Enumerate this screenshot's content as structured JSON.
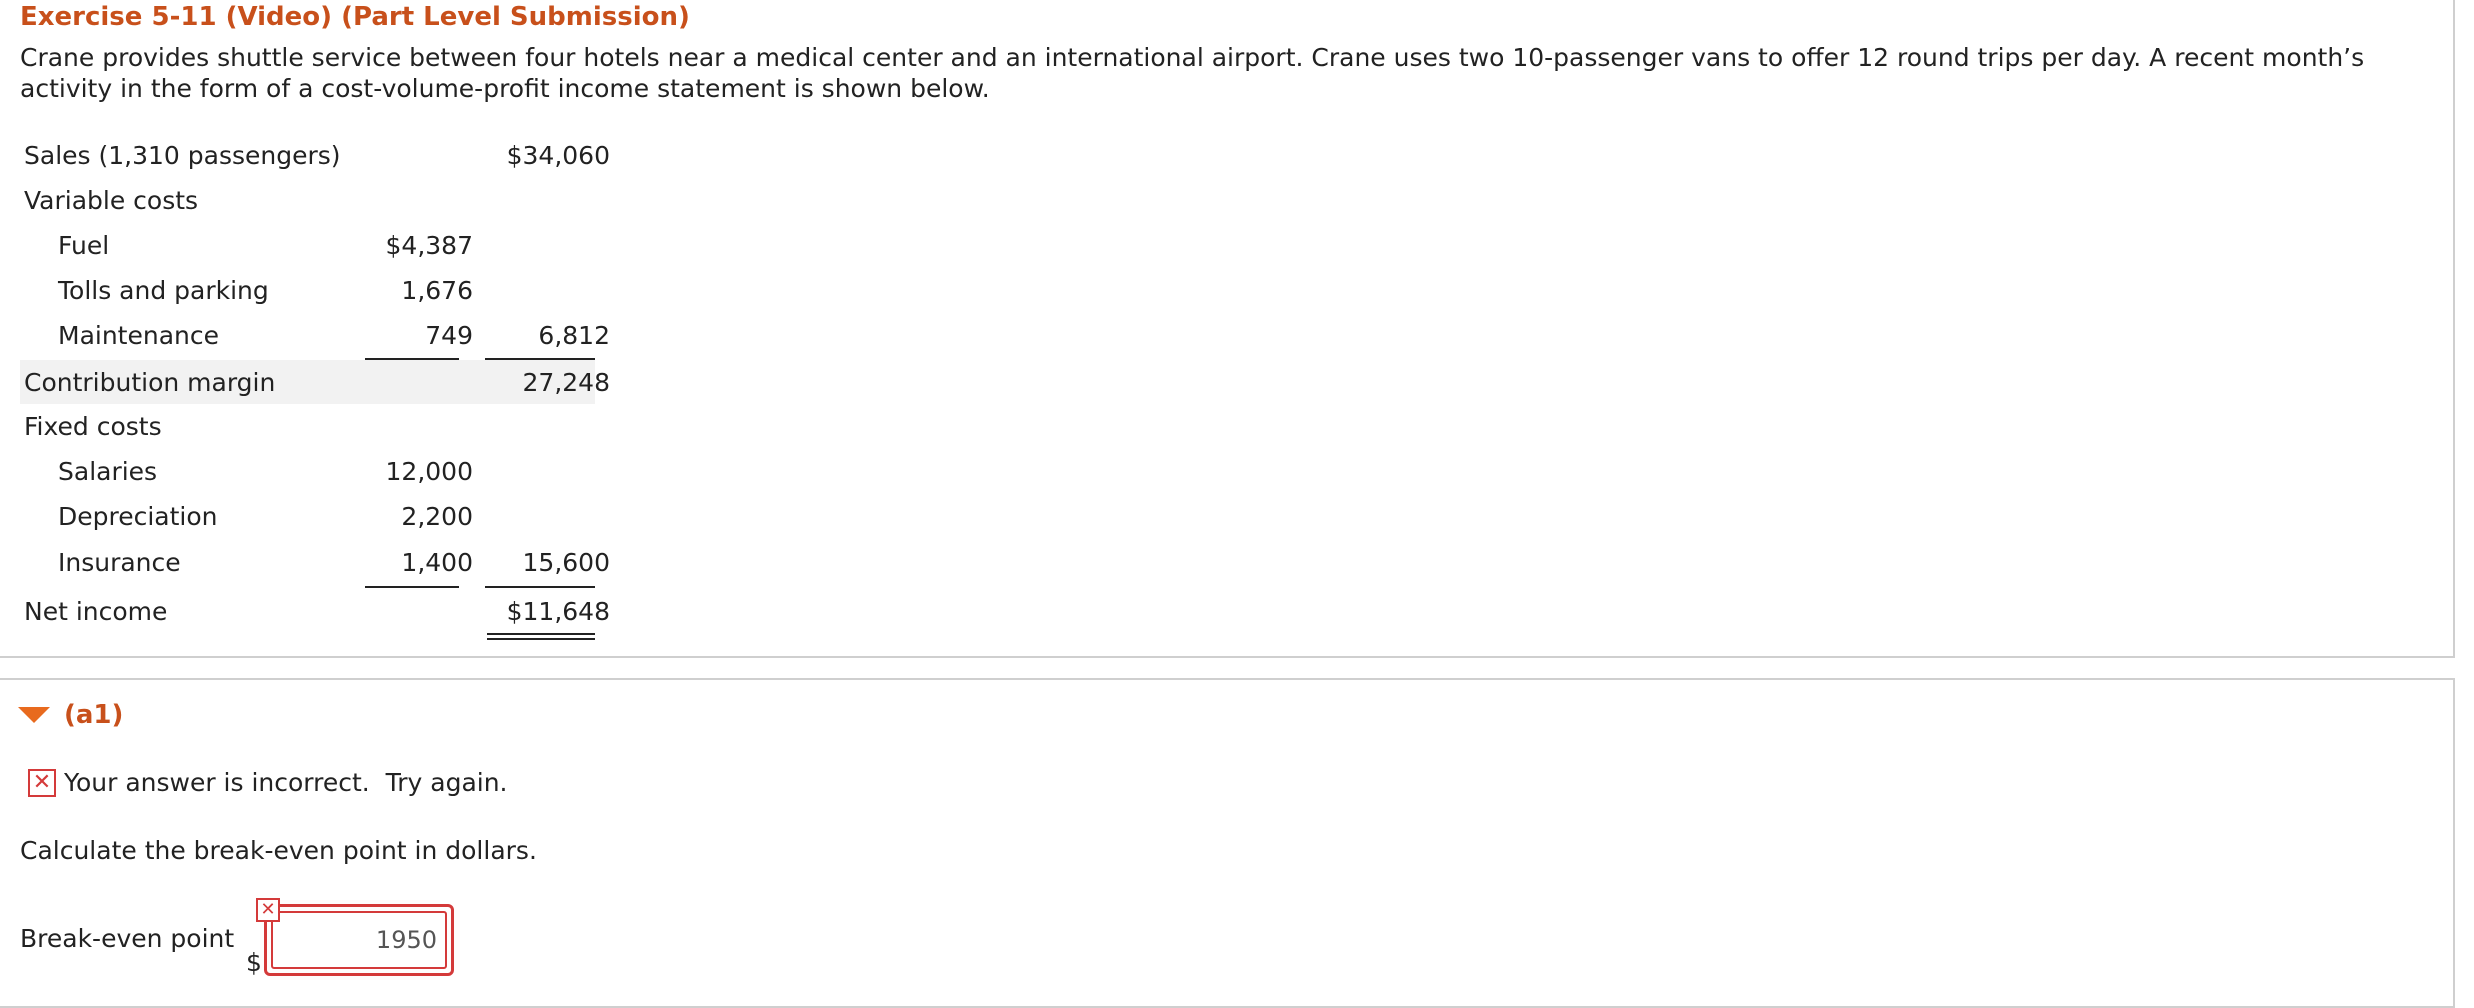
{
  "title": "Exercise 5-11 (Video) (Part Level Submission)",
  "description": "Crane provides shuttle service between four hotels near a medical center and an international airport. Crane uses two 10-passenger vans to offer 12 round trips per day. A recent month’s activity in the form of a cost-volume-profit income statement is shown below.",
  "statement": {
    "sales": {
      "label": "Sales (1,310 passengers)",
      "total": "$34,060"
    },
    "variable_costs": {
      "label": "Variable costs"
    },
    "fuel": {
      "label": "Fuel",
      "amount": "$4,387"
    },
    "tolls": {
      "label": "Tolls and parking",
      "amount": "1,676"
    },
    "maintenance": {
      "label": "Maintenance",
      "amount": "749",
      "total": "6,812"
    },
    "contribution_margin": {
      "label": "Contribution margin",
      "total": "27,248"
    },
    "fixed_costs": {
      "label": "Fixed costs"
    },
    "salaries": {
      "label": "Salaries",
      "amount": "12,000"
    },
    "depreciation": {
      "label": "Depreciation",
      "amount": "2,200"
    },
    "insurance": {
      "label": "Insurance",
      "amount": "1,400",
      "total": "15,600"
    },
    "net_income": {
      "label": "Net income",
      "total": "$11,648"
    }
  },
  "part": {
    "label": "(a1)",
    "feedback": "Your answer is incorrect.  Try again.",
    "question": "Calculate the break-even point in dollars.",
    "input_label": "Break-even point",
    "currency": "$",
    "input_value": "1950"
  },
  "icons": {
    "toggle": "triangle-down-icon",
    "error": "x-icon"
  },
  "colors": {
    "title": "#c8501b",
    "toggle": "#e86a1e",
    "error": "#d43a3a",
    "shaded_row": "#f2f2f2"
  }
}
